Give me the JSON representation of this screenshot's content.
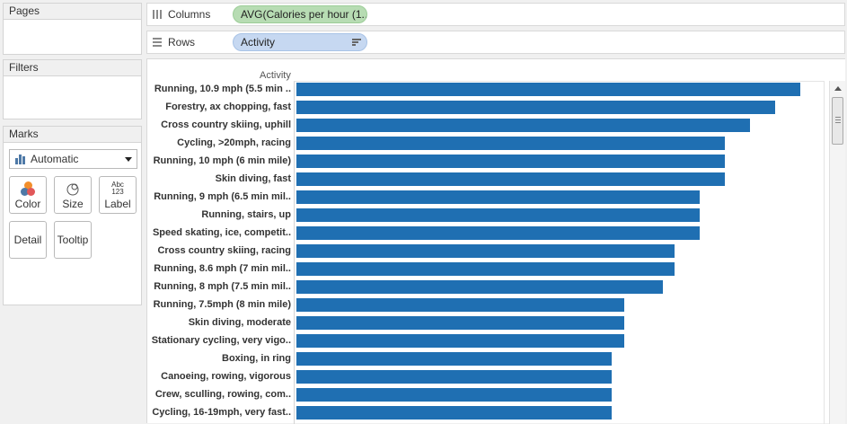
{
  "panels": {
    "pages_title": "Pages",
    "filters_title": "Filters",
    "marks_title": "Marks"
  },
  "marks": {
    "type_selected": "Automatic",
    "buttons": {
      "color": "Color",
      "size": "Size",
      "label": "Label",
      "detail": "Detail",
      "tooltip": "Tooltip"
    },
    "label_icon_text": {
      "line1": "Abc",
      "line2": "123"
    }
  },
  "shelves": {
    "columns": {
      "label": "Columns",
      "pill": "AVG(Calories per hour (1.."
    },
    "rows": {
      "label": "Rows",
      "pill": "Activity"
    }
  },
  "colors": {
    "bar": "#1f6fb2",
    "columns_pill": "#b7dcb3",
    "rows_pill": "#c6d8f1"
  },
  "chart_data": {
    "type": "bar",
    "orientation": "horizontal",
    "row_header": "Activity",
    "categories": [
      "Running, 10.9 mph (5.5 min ..",
      "Forestry, ax chopping, fast",
      "Cross country skiing, uphill",
      "Cycling, >20mph, racing",
      "Running, 10 mph (6 min mile)",
      "Skin diving, fast",
      "Running, 9 mph (6.5 min mil..",
      "Running, stairs, up",
      "Speed skating, ice, competit..",
      "Cross country skiing, racing",
      "Running, 8.6 mph (7 min mil..",
      "Running, 8 mph (7.5 min mil..",
      "Running, 7.5mph (8 min mile)",
      "Skin diving, moderate",
      "Stationary cycling, very vigo..",
      "Boxing, in ring",
      "Canoeing, rowing, vigorous",
      "Crew, sculling, rowing, com..",
      "Cycling, 16-19mph, very fast.."
    ],
    "values": [
      1.0,
      0.95,
      0.9,
      0.85,
      0.85,
      0.85,
      0.8,
      0.8,
      0.8,
      0.75,
      0.75,
      0.7275,
      0.65,
      0.65,
      0.65,
      0.625,
      0.625,
      0.625,
      0.625
    ],
    "xlim": [
      0,
      1.0
    ],
    "value_note": "relative to the longest bar"
  }
}
